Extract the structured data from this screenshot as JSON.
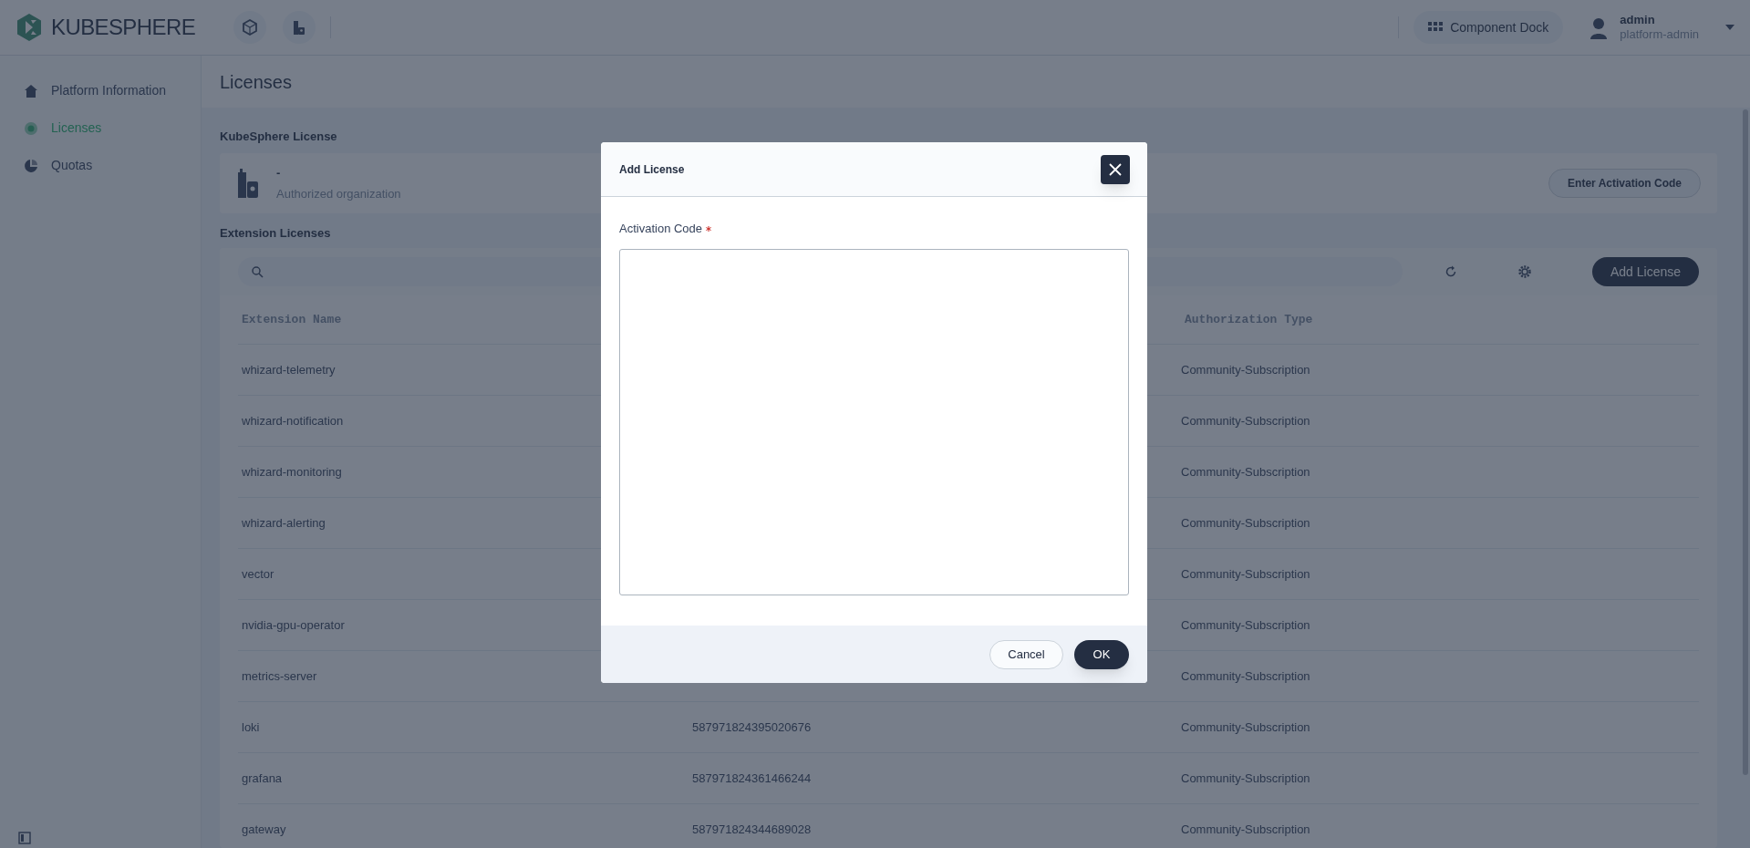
{
  "brand": {
    "name": "KUBESPHERE"
  },
  "top_bar": {
    "dock_label": "Component Dock",
    "user": {
      "name": "admin",
      "role": "platform-admin"
    }
  },
  "sidebar": {
    "items": [
      {
        "label": "Platform Information",
        "selected": false
      },
      {
        "label": "Licenses",
        "selected": true
      },
      {
        "label": "Quotas",
        "selected": false
      }
    ]
  },
  "page": {
    "title": "Licenses",
    "kubesphere_license": {
      "heading": "KubeSphere License",
      "organization": "-",
      "organization_label": "Authorized organization",
      "button": "Enter Activation Code"
    },
    "extension_licenses": {
      "heading": "Extension Licenses",
      "add_button": "Add License",
      "columns": [
        "Extension Name",
        null,
        "Authorization Type"
      ],
      "rows": [
        {
          "name": "whizard-telemetry",
          "auth": "Community-Subscription"
        },
        {
          "name": "whizard-notification",
          "auth": "Community-Subscription"
        },
        {
          "name": "whizard-monitoring",
          "auth": "Community-Subscription"
        },
        {
          "name": "whizard-alerting",
          "auth": "Community-Subscription"
        },
        {
          "name": "vector",
          "auth": "Community-Subscription"
        },
        {
          "name": "nvidia-gpu-operator",
          "auth": "Community-Subscription"
        },
        {
          "name": "metrics-server",
          "auth": "Community-Subscription"
        },
        {
          "name": "loki",
          "column_2": "587971824395020676",
          "auth": "Community-Subscription"
        },
        {
          "name": "grafana",
          "column_2": "587971824361466244",
          "auth": "Community-Subscription"
        },
        {
          "name": "gateway",
          "column_2": "587971824344689028",
          "auth": "Community-Subscription"
        }
      ]
    }
  },
  "dialog": {
    "title": "Add License",
    "field_label": "Activation Code",
    "required": true,
    "buttons": {
      "cancel": "Cancel",
      "ok": "OK"
    }
  }
}
